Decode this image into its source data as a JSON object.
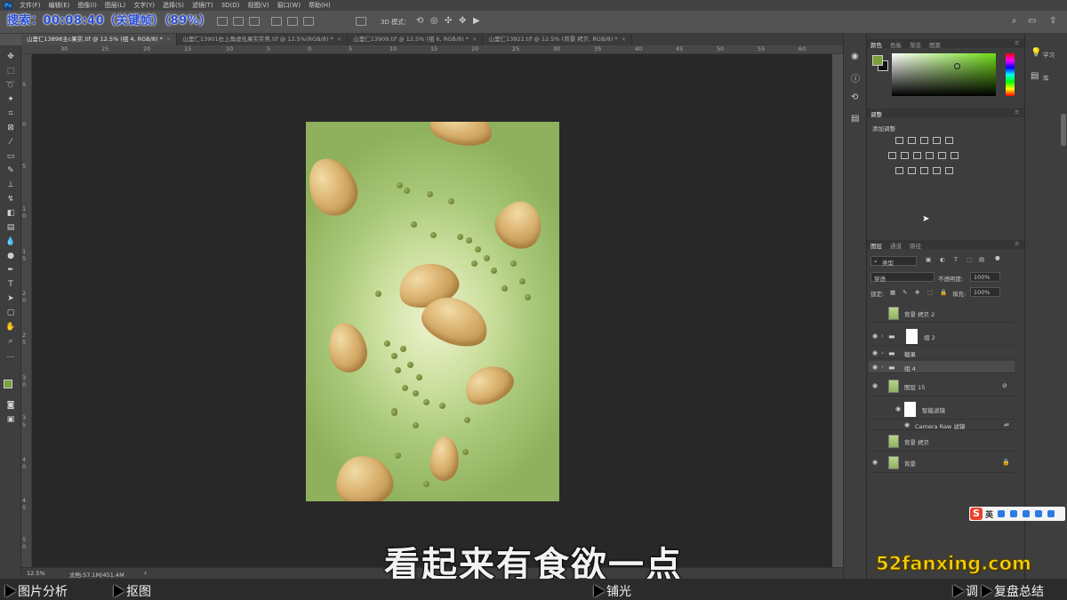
{
  "app": {
    "menu": [
      "文件(F)",
      "编辑(E)",
      "图像(I)",
      "图层(L)",
      "文字(Y)",
      "选择(S)",
      "滤镜(T)",
      "3D(D)",
      "视图(V)",
      "窗口(W)",
      "帮助(H)"
    ],
    "search_overlay": "搜索：00:08:40（关键帧）（89%）",
    "options_3d_label": "3D 模式："
  },
  "tabs": [
    {
      "label": "山里仁13898主c果实.tif @ 12.5% (组 4, RGB/8) *",
      "active": true
    },
    {
      "label": "山里仁13901右上角虚化果实实焦.tif @ 12.5%(RGB/8) *",
      "active": false
    },
    {
      "label": "山里仁13909.tif @ 12.5% (组 6, RGB/8) *",
      "active": false
    },
    {
      "label": "山里仁13922.tif @ 12.5% (背景 拷贝, RGB/8) *",
      "active": false
    }
  ],
  "ruler_top": [
    "30",
    "25",
    "20",
    "15",
    "10",
    "5",
    "0",
    "5",
    "10",
    "15",
    "20",
    "25",
    "30",
    "35",
    "40",
    "45",
    "50",
    "55",
    "60"
  ],
  "ruler_left": [
    "5",
    "0",
    "5",
    "1 0",
    "1 5",
    "2 0",
    "2 5",
    "3 0",
    "3 5",
    "4 0",
    "4 5",
    "5 0"
  ],
  "status": {
    "zoom": "12.5%",
    "doc": "文档:57.1M/451.4M"
  },
  "color_panel": {
    "tabs": [
      "颜色",
      "色板",
      "渐变",
      "图案"
    ],
    "fg_color": "#7aa03a",
    "bg_color": "#111111",
    "spectrum_hue": "#6fdc16"
  },
  "adjust_panel": {
    "tab": "调整",
    "add_label": "添加调整"
  },
  "layers_panel": {
    "tabs": [
      "图层",
      "通道",
      "路径"
    ],
    "filter_kind": "类型",
    "blend_mode": "穿透",
    "opacity_label": "不透明度:",
    "opacity_value": "100%",
    "lock_label": "锁定:",
    "fill_label": "填充:",
    "fill_value": "100%",
    "layers": [
      {
        "name": "背景 拷贝 2",
        "visible": false,
        "kind": "image"
      },
      {
        "name": "组 2",
        "visible": true,
        "kind": "group-mask"
      },
      {
        "name": "糖果",
        "visible": true,
        "kind": "group"
      },
      {
        "name": "组 4",
        "visible": true,
        "kind": "group",
        "selected": true
      },
      {
        "name": "图层 15",
        "visible": true,
        "kind": "smart"
      },
      {
        "name": "智能滤镜",
        "visible": true,
        "kind": "filter-mask"
      },
      {
        "name": "Camera Raw 滤镜",
        "visible": true,
        "kind": "filter"
      },
      {
        "name": "背景 拷贝",
        "visible": false,
        "kind": "image"
      },
      {
        "name": "背景",
        "visible": true,
        "kind": "image-locked"
      }
    ]
  },
  "right_strip": {
    "learn": "学习",
    "library": "库"
  },
  "ime": {
    "label": "英"
  },
  "subtitle": "看起来有食欲一点",
  "watermark": "52fanxing.com",
  "bottom_bar": {
    "items": [
      "图片分析",
      "抠图",
      "铺光",
      "调",
      "复盘总结"
    ]
  }
}
